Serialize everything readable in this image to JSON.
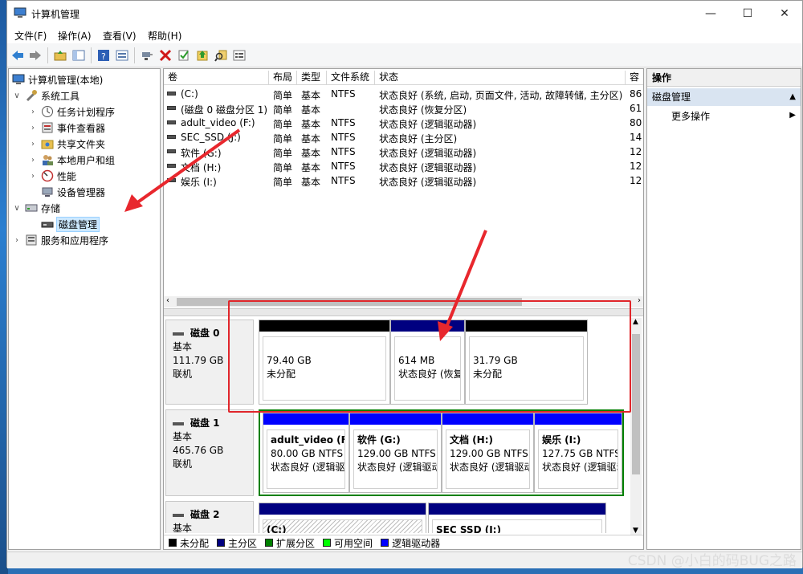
{
  "window": {
    "title": "计算机管理",
    "minimize": "—",
    "maximize": "☐",
    "close": "✕"
  },
  "menu": [
    {
      "label": "文件(F)"
    },
    {
      "label": "操作(A)"
    },
    {
      "label": "查看(V)"
    },
    {
      "label": "帮助(H)"
    }
  ],
  "tree": {
    "root": "计算机管理(本地)",
    "system_tools": "系统工具",
    "task_scheduler": "任务计划程序",
    "event_viewer": "事件查看器",
    "shared_folders": "共享文件夹",
    "local_users": "本地用户和组",
    "performance": "性能",
    "device_manager": "设备管理器",
    "storage": "存储",
    "disk_management": "磁盘管理",
    "services_apps": "服务和应用程序"
  },
  "volume_list": {
    "headers": [
      "卷",
      "布局",
      "类型",
      "文件系统",
      "状态",
      "容"
    ],
    "rows": [
      {
        "volume": "(C:)",
        "layout": "简单",
        "type": "基本",
        "fs": "NTFS",
        "status": "状态良好 (系统, 启动, 页面文件, 活动, 故障转储, 主分区)",
        "cap": "86"
      },
      {
        "volume": "(磁盘 0 磁盘分区 1)",
        "layout": "简单",
        "type": "基本",
        "fs": "",
        "status": "状态良好 (恢复分区)",
        "cap": "61"
      },
      {
        "volume": "adult_video (F:)",
        "layout": "简单",
        "type": "基本",
        "fs": "NTFS",
        "status": "状态良好 (逻辑驱动器)",
        "cap": "80"
      },
      {
        "volume": "SEC_SSD (J:)",
        "layout": "简单",
        "type": "基本",
        "fs": "NTFS",
        "status": "状态良好 (主分区)",
        "cap": "14"
      },
      {
        "volume": "软件 (G:)",
        "layout": "简单",
        "type": "基本",
        "fs": "NTFS",
        "status": "状态良好 (逻辑驱动器)",
        "cap": "12"
      },
      {
        "volume": "文档 (H:)",
        "layout": "简单",
        "type": "基本",
        "fs": "NTFS",
        "status": "状态良好 (逻辑驱动器)",
        "cap": "12"
      },
      {
        "volume": "娱乐 (I:)",
        "layout": "简单",
        "type": "基本",
        "fs": "NTFS",
        "status": "状态良好 (逻辑驱动器)",
        "cap": "12"
      }
    ]
  },
  "disks": [
    {
      "name": "磁盘 0",
      "type": "基本",
      "size": "111.79 GB",
      "state": "联机",
      "partitions": [
        {
          "title": "",
          "size": "79.40 GB",
          "status": "未分配",
          "bar_color": "#000000"
        },
        {
          "title": "",
          "size": "614 MB",
          "status": "状态良好 (恢复",
          "bar_color": "#000080"
        },
        {
          "title": "",
          "size": "31.79 GB",
          "status": "未分配",
          "bar_color": "#000000"
        }
      ]
    },
    {
      "name": "磁盘 1",
      "type": "基本",
      "size": "465.76 GB",
      "state": "联机",
      "partitions": [
        {
          "title": "adult_video (F",
          "size": "80.00 GB NTFS",
          "status": "状态良好 (逻辑驱",
          "bar_color": "#0000ff"
        },
        {
          "title": "软件 (G:)",
          "size": "129.00 GB NTFS",
          "status": "状态良好 (逻辑驱动",
          "bar_color": "#0000ff"
        },
        {
          "title": "文档 (H:)",
          "size": "129.00 GB NTFS",
          "status": "状态良好 (逻辑驱动",
          "bar_color": "#0000ff"
        },
        {
          "title": "娱乐 (I:)",
          "size": "127.75 GB NTFS",
          "status": "状态良好 (逻辑驱动",
          "bar_color": "#0000ff"
        }
      ]
    },
    {
      "name": "磁盘 2",
      "type": "基本",
      "partitions": [
        {
          "title": "(C:)",
          "bar_color": "#000080"
        },
        {
          "title": "SEC SSD (J:)",
          "bar_color": "#000080"
        }
      ]
    }
  ],
  "legend": [
    {
      "label": "未分配",
      "color": "#000000"
    },
    {
      "label": "主分区",
      "color": "#000080"
    },
    {
      "label": "扩展分区",
      "color": "#008000"
    },
    {
      "label": "可用空间",
      "color": "#00ff00"
    },
    {
      "label": "逻辑驱动器",
      "color": "#0000ff"
    }
  ],
  "actions": {
    "header": "操作",
    "section": "磁盘管理",
    "more": "更多操作"
  },
  "watermark": "CSDN @小白的码BUG之路"
}
